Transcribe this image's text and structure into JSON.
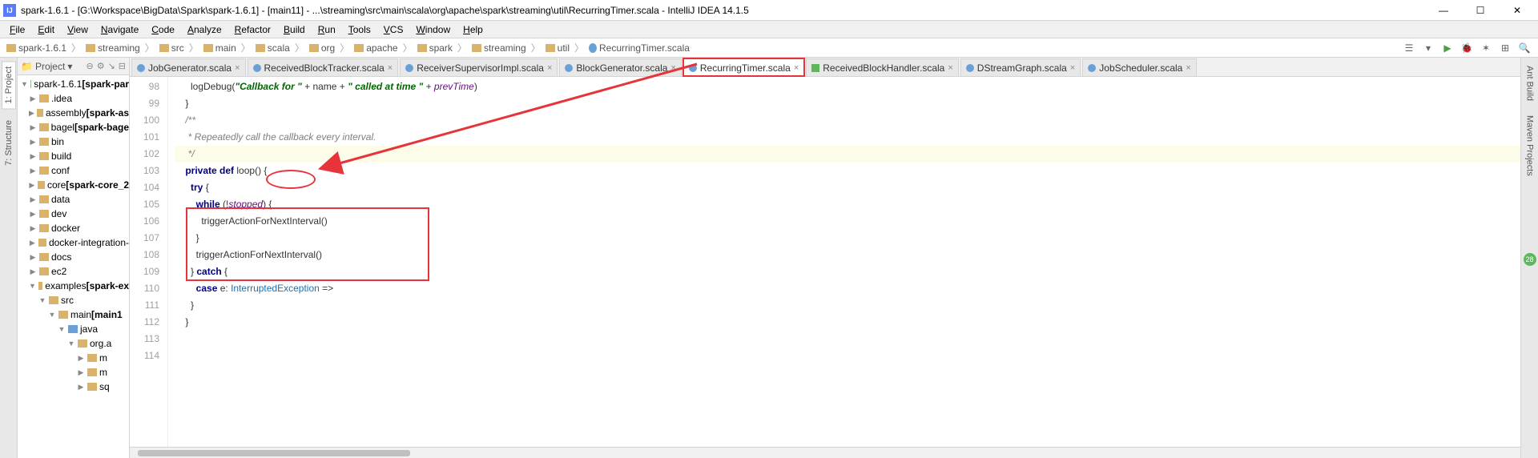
{
  "title": "spark-1.6.1 - [G:\\Workspace\\BigData\\Spark\\spark-1.6.1] - [main11] - ...\\streaming\\src\\main\\scala\\org\\apache\\spark\\streaming\\util\\RecurringTimer.scala - IntelliJ IDEA 14.1.5",
  "menu": [
    "File",
    "Edit",
    "View",
    "Navigate",
    "Code",
    "Analyze",
    "Refactor",
    "Build",
    "Run",
    "Tools",
    "VCS",
    "Window",
    "Help"
  ],
  "breadcrumb": [
    "spark-1.6.1",
    "streaming",
    "src",
    "main",
    "scala",
    "org",
    "apache",
    "spark",
    "streaming",
    "util",
    "RecurringTimer.scala"
  ],
  "tree_header": {
    "label": "Project"
  },
  "tree": [
    {
      "depth": 0,
      "arrow": "▼",
      "ico": "ico-module",
      "label": "spark-1.6.1",
      "suffix": "[spark-par"
    },
    {
      "depth": 1,
      "arrow": "▶",
      "ico": "ico-folder",
      "label": ".idea",
      "suffix": ""
    },
    {
      "depth": 1,
      "arrow": "▶",
      "ico": "ico-folder",
      "label": "assembly",
      "suffix": "[spark-as"
    },
    {
      "depth": 1,
      "arrow": "▶",
      "ico": "ico-folder",
      "label": "bagel",
      "suffix": "[spark-bage"
    },
    {
      "depth": 1,
      "arrow": "▶",
      "ico": "ico-folder",
      "label": "bin",
      "suffix": ""
    },
    {
      "depth": 1,
      "arrow": "▶",
      "ico": "ico-folder",
      "label": "build",
      "suffix": ""
    },
    {
      "depth": 1,
      "arrow": "▶",
      "ico": "ico-folder",
      "label": "conf",
      "suffix": ""
    },
    {
      "depth": 1,
      "arrow": "▶",
      "ico": "ico-folder",
      "label": "core",
      "suffix": "[spark-core_2"
    },
    {
      "depth": 1,
      "arrow": "▶",
      "ico": "ico-folder",
      "label": "data",
      "suffix": ""
    },
    {
      "depth": 1,
      "arrow": "▶",
      "ico": "ico-folder",
      "label": "dev",
      "suffix": ""
    },
    {
      "depth": 1,
      "arrow": "▶",
      "ico": "ico-folder",
      "label": "docker",
      "suffix": ""
    },
    {
      "depth": 1,
      "arrow": "▶",
      "ico": "ico-folder",
      "label": "docker-integration-",
      "suffix": ""
    },
    {
      "depth": 1,
      "arrow": "▶",
      "ico": "ico-folder",
      "label": "docs",
      "suffix": ""
    },
    {
      "depth": 1,
      "arrow": "▶",
      "ico": "ico-folder",
      "label": "ec2",
      "suffix": ""
    },
    {
      "depth": 1,
      "arrow": "▼",
      "ico": "ico-folder",
      "label": "examples",
      "suffix": "[spark-ex"
    },
    {
      "depth": 2,
      "arrow": "▼",
      "ico": "ico-folder",
      "label": "src",
      "suffix": ""
    },
    {
      "depth": 3,
      "arrow": "▼",
      "ico": "ico-folder",
      "label": "main",
      "suffix": "[main1"
    },
    {
      "depth": 4,
      "arrow": "▼",
      "ico": "ico-folder-blue",
      "label": "java",
      "suffix": ""
    },
    {
      "depth": 5,
      "arrow": "▼",
      "ico": "ico-folder",
      "label": "org.a",
      "suffix": ""
    },
    {
      "depth": 6,
      "arrow": "▶",
      "ico": "ico-folder",
      "label": "m",
      "suffix": ""
    },
    {
      "depth": 6,
      "arrow": "▶",
      "ico": "ico-folder",
      "label": "m",
      "suffix": ""
    },
    {
      "depth": 6,
      "arrow": "▶",
      "ico": "ico-folder",
      "label": "sq",
      "suffix": ""
    }
  ],
  "tabs": [
    {
      "name": "JobGenerator.scala",
      "active": false,
      "ico": "tico"
    },
    {
      "name": "ReceivedBlockTracker.scala",
      "active": false,
      "ico": "tico"
    },
    {
      "name": "ReceiverSupervisorImpl.scala",
      "active": false,
      "ico": "tico"
    },
    {
      "name": "BlockGenerator.scala",
      "active": false,
      "ico": "tico"
    },
    {
      "name": "RecurringTimer.scala",
      "active": true,
      "ico": "tico",
      "highlight": true
    },
    {
      "name": "ReceivedBlockHandler.scala",
      "active": false,
      "ico": "tico test"
    },
    {
      "name": "DStreamGraph.scala",
      "active": false,
      "ico": "tico"
    },
    {
      "name": "JobScheduler.scala",
      "active": false,
      "ico": "tico"
    }
  ],
  "gutter_lines": [
    "98",
    "99",
    "100",
    "101",
    "102",
    "103",
    "104",
    "105",
    "106",
    "107",
    "108",
    "109",
    "110",
    "111",
    "112",
    "113",
    "114"
  ],
  "code": {
    "l98_a": "      logDebug(",
    "l98_s1": "\"Callback for \"",
    "l98_b": " + name + ",
    "l98_s2": "\" called at time \"",
    "l98_c": " + ",
    "l98_id": "prevTime",
    "l98_d": ")",
    "l99": "    }",
    "l100": "",
    "l101": "    /**",
    "l102": "     * Repeatedly call the callback every interval.",
    "l103": "     */",
    "l104_kw1": "private",
    "l104_kw2": "def",
    "l104_fn": "loop",
    "l104_rest": "() {",
    "l105_kw": "try",
    "l105_rest": " {",
    "l106_kw": "while",
    "l106_a": " (!",
    "l106_id": "stopped",
    "l106_b": ") {",
    "l107": "          triggerActionForNextInterval()",
    "l108": "        }",
    "l109": "        triggerActionForNextInterval()",
    "l110_a": "      } ",
    "l110_kw": "catch",
    "l110_b": " {",
    "l111_kw": "case",
    "l111_a": " e: ",
    "l111_ty": "InterruptedException",
    "l111_b": " =>",
    "l112": "      }",
    "l113": "    }",
    "l114": ""
  },
  "left_vtabs": [
    "1: Project",
    "7: Structure"
  ],
  "right_vtabs": [
    "Ant Build",
    "Maven Projects"
  ],
  "right_badge": "28"
}
